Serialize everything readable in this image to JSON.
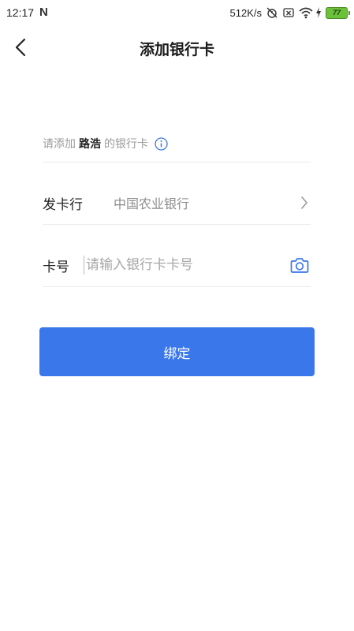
{
  "status_bar": {
    "time": "12:17",
    "network_speed": "512K/s",
    "battery_level": "77"
  },
  "header": {
    "title": "添加银行卡"
  },
  "form": {
    "hint_prefix": "请添加",
    "holder_name": "路浩",
    "hint_suffix": "的银行卡",
    "issuer_label": "发卡行",
    "issuer_value": "中国农业银行",
    "card_label": "卡号",
    "card_placeholder": "请输入银行卡卡号",
    "card_value": ""
  },
  "actions": {
    "bind_label": "绑定"
  },
  "colors": {
    "primary": "#3a77ea",
    "divider": "#ebebeb",
    "hint_text": "#9a9a9a"
  },
  "icons": [
    "back-arrow-icon",
    "info-icon",
    "chevron-right-icon",
    "camera-icon",
    "wifi-icon",
    "battery-icon"
  ]
}
